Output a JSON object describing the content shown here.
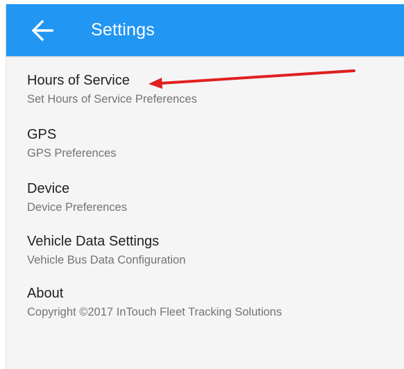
{
  "app_bar": {
    "title": "Settings",
    "back_icon": "arrow-left-icon",
    "color": "#2196f3"
  },
  "preferences": [
    {
      "title": "Hours of Service",
      "summary": "Set Hours of Service Preferences"
    },
    {
      "title": "GPS",
      "summary": "GPS Preferences"
    },
    {
      "title": "Device",
      "summary": "Device Preferences"
    },
    {
      "title": "Vehicle Data Settings",
      "summary": "Vehicle Bus Data Configuration"
    },
    {
      "title": "About",
      "summary": "Copyright ©2017 InTouch Fleet Tracking Solutions"
    }
  ],
  "annotation": {
    "type": "arrow",
    "color": "#e02020",
    "points_to": "Hours of Service"
  }
}
